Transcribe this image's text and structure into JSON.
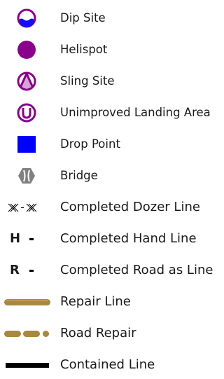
{
  "legend": {
    "items": [
      {
        "label": "Dip Site",
        "icon": "dip-site-icon",
        "color": "#8B008B"
      },
      {
        "label": "Helispot",
        "icon": "helispot-icon",
        "color": "#8B008B"
      },
      {
        "label": "Sling Site",
        "icon": "sling-site-icon",
        "color": "#8B008B"
      },
      {
        "label": "Unimproved Landing Area",
        "icon": "unimproved-landing-area-icon",
        "color": "#8B008B"
      },
      {
        "label": "Drop Point",
        "icon": "drop-point-icon",
        "color": "#0000FF"
      },
      {
        "label": "Bridge",
        "icon": "bridge-icon",
        "color": "#777777"
      },
      {
        "label": "Completed Dozer Line",
        "icon": "completed-dozer-line-icon",
        "color": "#000000"
      },
      {
        "label": "Completed Hand Line",
        "icon": "completed-hand-line-icon",
        "symbol": "H",
        "color": "#000000"
      },
      {
        "label": "Completed Road as Line",
        "icon": "completed-road-as-line-icon",
        "symbol": "R",
        "color": "#000000"
      },
      {
        "label": "Repair Line",
        "icon": "repair-line-icon",
        "color": "#A8873F"
      },
      {
        "label": "Road Repair",
        "icon": "road-repair-icon",
        "color": "#A8873F"
      },
      {
        "label": "Contained Line",
        "icon": "contained-line-icon",
        "color": "#000000"
      }
    ]
  }
}
